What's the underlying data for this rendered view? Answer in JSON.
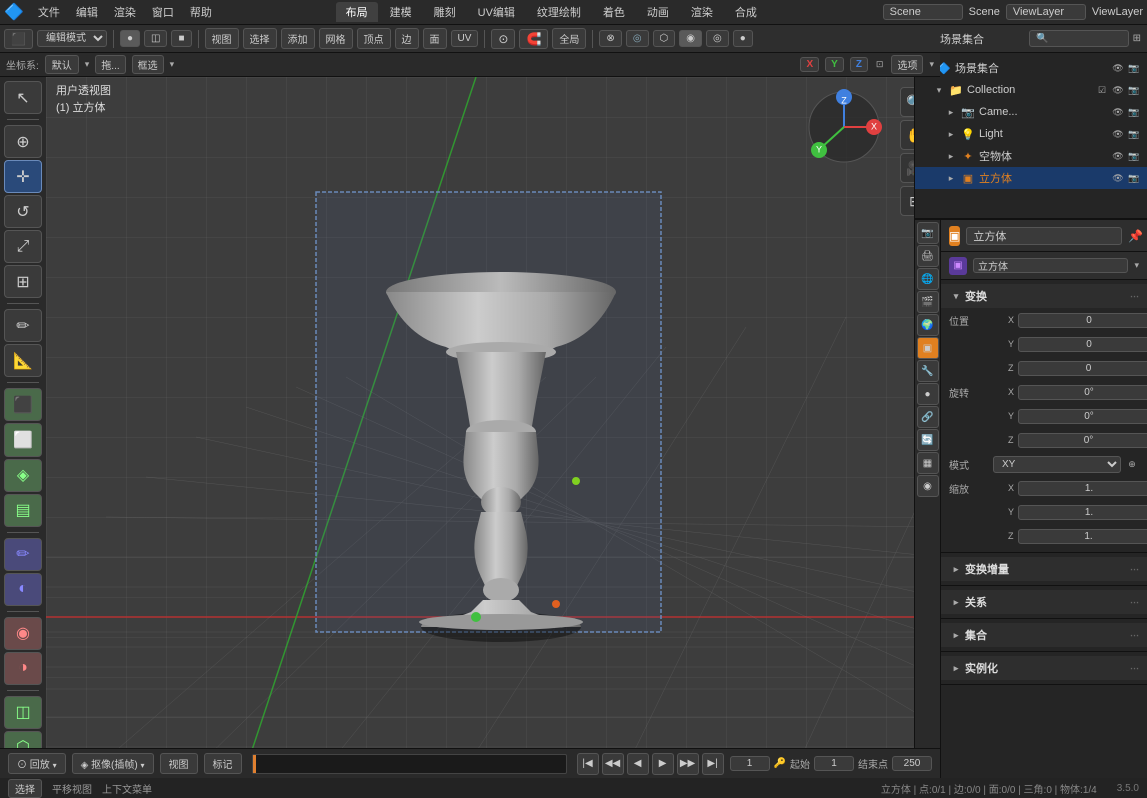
{
  "app": {
    "title": "Blender",
    "version": "3.5.0"
  },
  "top_menu": {
    "items": [
      "文件",
      "编辑",
      "渲染",
      "窗口",
      "帮助"
    ],
    "logo": "🔵"
  },
  "top_tabs": {
    "items": [
      "布局",
      "建模",
      "雕刻",
      "UV编辑",
      "纹理绘制",
      "着色",
      "动画",
      "渲染",
      "合成"
    ],
    "active": "布局"
  },
  "top_right": {
    "scene_label": "Scene",
    "viewlayer_label": "ViewLayer",
    "icons": [
      "🔍",
      "⚙"
    ]
  },
  "toolbar": {
    "mode_label": "编辑模式",
    "view_label": "视图",
    "select_label": "选择",
    "add_label": "添加",
    "mesh_label": "网格",
    "vertex_label": "顶点",
    "edge_label": "边",
    "face_label": "面",
    "uv_label": "UV",
    "global_label": "全局",
    "select_mode_label": "选项"
  },
  "coord_bar": {
    "coord_label": "坐标系:",
    "coord_val": "默认",
    "drag_label": "拖...",
    "box_label": "框选",
    "xyz": [
      "X",
      "Y",
      "Z"
    ],
    "select_label": "选项"
  },
  "left_tools": [
    {
      "icon": "↖",
      "label": "select",
      "active": false
    },
    {
      "icon": "✛",
      "label": "cursor",
      "active": false
    },
    {
      "icon": "✥",
      "label": "move",
      "active": true
    },
    {
      "icon": "↺",
      "label": "rotate",
      "active": false
    },
    {
      "icon": "⤢",
      "label": "scale",
      "active": false
    },
    {
      "icon": "▭",
      "label": "transform",
      "active": false
    },
    {
      "icon": "◳",
      "label": "annotate",
      "active": false
    },
    {
      "icon": "◻",
      "label": "measure",
      "active": false
    },
    {
      "sep": true
    },
    {
      "icon": "◼",
      "label": "extrude",
      "active": false
    },
    {
      "icon": "⬛",
      "label": "inset",
      "active": false
    },
    {
      "icon": "⬜",
      "label": "bevel",
      "active": false
    },
    {
      "icon": "◈",
      "label": "loop-cut",
      "active": false
    },
    {
      "sep": true
    },
    {
      "icon": "✏",
      "label": "draw",
      "active": false
    },
    {
      "icon": "◐",
      "label": "smooth",
      "active": false
    },
    {
      "sep": true
    },
    {
      "icon": "◉",
      "label": "shading1",
      "active": false
    },
    {
      "icon": "◑",
      "label": "shading2",
      "active": false
    },
    {
      "sep": true
    },
    {
      "icon": "◫",
      "label": "box1",
      "active": false
    },
    {
      "icon": "⬡",
      "label": "box2",
      "active": false
    }
  ],
  "viewport": {
    "header_line1": "用户透视图",
    "header_line2": "(1) 立方体",
    "camera_label": "Camera",
    "light_label": "Light",
    "empty_label": "空物体",
    "cube_label": "立方体"
  },
  "vp_right_tools": [
    {
      "icon": "🔍",
      "label": "zoom-in"
    },
    {
      "icon": "🖐",
      "label": "pan"
    },
    {
      "icon": "🎥",
      "label": "camera-view"
    },
    {
      "icon": "⊞",
      "label": "grid-view"
    }
  ],
  "bottom_bar": {
    "playback_mode": "回放",
    "interp_label": "抠像(插帧)",
    "view_label": "视图",
    "mark_label": "标记",
    "frame_number": "1",
    "start_label": "起始",
    "start_frame": "1",
    "end_label": "结束点",
    "end_frame": "250"
  },
  "status_bar": {
    "select_label": "选择",
    "translate_label": "平移视图",
    "menu_label": "上下文菜单",
    "stats": "立方体 | 点:0/1 | 边:0/0 | 面:0/0 | 三角:0 | 物体:1/4",
    "version": "3.5.0"
  },
  "outliner": {
    "title": "场景集合",
    "items": [
      {
        "name": "Collection",
        "icon": "📁",
        "level": 1,
        "expanded": true,
        "type": "collection",
        "visible": true,
        "eye": true
      },
      {
        "name": "Came...",
        "icon": "📷",
        "level": 2,
        "expanded": false,
        "type": "camera",
        "visible": true,
        "eye": true
      },
      {
        "name": "Light",
        "icon": "💡",
        "level": 2,
        "expanded": false,
        "type": "light",
        "visible": true,
        "eye": true
      },
      {
        "name": "空物体",
        "icon": "✦",
        "level": 2,
        "expanded": false,
        "type": "empty",
        "visible": true,
        "eye": true
      },
      {
        "name": "立方体",
        "icon": "▣",
        "level": 2,
        "expanded": false,
        "type": "mesh",
        "active": true,
        "visible": true,
        "eye": true
      }
    ]
  },
  "properties": {
    "object_name": "立方体",
    "object_data_name": "立方体",
    "transform_label": "变换",
    "position": {
      "label": "位置",
      "x": "0",
      "y": "0",
      "z": "0"
    },
    "rotation": {
      "label": "旋转",
      "x": "0°",
      "y": "0°",
      "z": "0°"
    },
    "scale": {
      "label": "缩放",
      "x": "1.",
      "y": "1.",
      "z": "1."
    },
    "mode_label": "模式",
    "mode_val": "XY",
    "relations_label": "关系",
    "collections_label": "集合",
    "instances_label": "实例化",
    "transform_extra": "变换增量"
  },
  "prop_side_icons": [
    {
      "icon": "🔧",
      "label": "tools-icon"
    },
    {
      "icon": "📷",
      "label": "render-icon"
    },
    {
      "icon": "⚙",
      "label": "output-icon"
    },
    {
      "icon": "👁",
      "label": "view-icon"
    },
    {
      "icon": "🌍",
      "label": "scene-icon"
    },
    {
      "icon": "🌐",
      "label": "world-icon"
    },
    {
      "icon": "▣",
      "label": "object-icon",
      "active": true
    },
    {
      "icon": "▦",
      "label": "modifier-icon"
    },
    {
      "icon": "●",
      "label": "particles-icon"
    },
    {
      "icon": "🔗",
      "label": "physics-icon"
    },
    {
      "icon": "◎",
      "label": "constraints-icon"
    },
    {
      "icon": "◉",
      "label": "data-icon"
    }
  ]
}
